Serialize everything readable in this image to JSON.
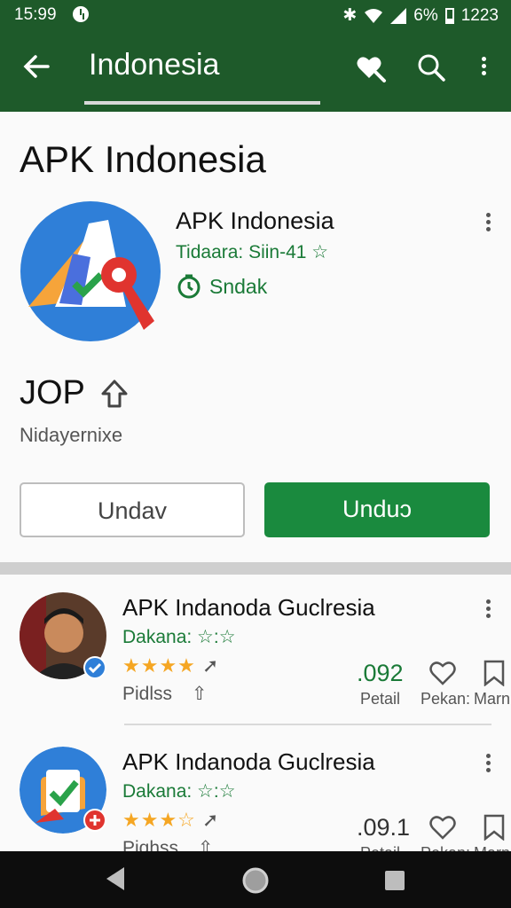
{
  "status": {
    "time": "15:99",
    "battery": "6%",
    "clock_right": "1223"
  },
  "appbar": {
    "title": "Indonesia",
    "icons": [
      "back-arrow-icon",
      "heart-search-icon",
      "search-icon",
      "more-vert-icon"
    ]
  },
  "app": {
    "heading": "APK Indonesia",
    "name": "APK Indonesia",
    "developer": "Tidaara: Siin-41 ☆",
    "stat_label": "Sndak",
    "big_label": "JOP",
    "sub_label": "Nidayernixe",
    "btn_secondary": "Undav",
    "btn_primary": "Unduɔ"
  },
  "list": [
    {
      "title": "APK Indanoda Guclresia",
      "dev": "Dakana: ☆:☆",
      "stars": "★★★★",
      "meta": "Pidlss",
      "price": ".092",
      "price_label": "Petail",
      "heart_label": "Pekan:",
      "bookmark_label": "Marn"
    },
    {
      "title": "APK Indanoda Guclresia",
      "dev": "Dakana: ☆:☆",
      "stars": "★★★☆",
      "meta": "Piqhss",
      "price": ".09.1",
      "price_label": "Petail",
      "heart_label": "Pekan:",
      "bookmark_label": "Marn"
    }
  ],
  "colors": {
    "brand": "#1e5a2a",
    "accent": "#1a8a3e",
    "star": "#f5a623"
  }
}
